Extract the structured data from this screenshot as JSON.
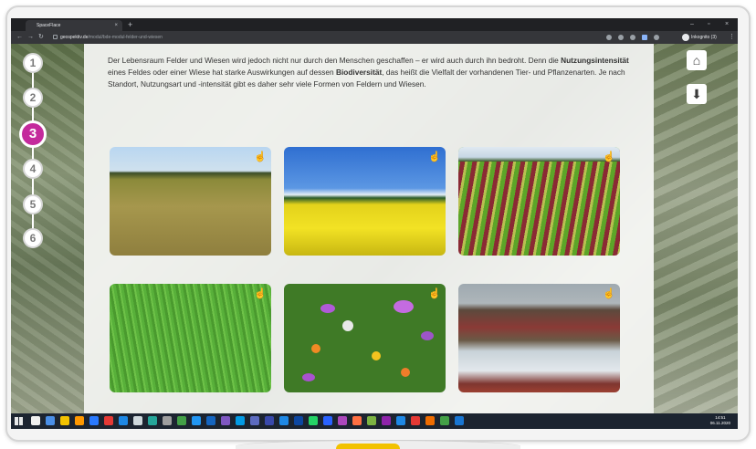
{
  "browser": {
    "tab_title": "SpaceFlace",
    "tab_close": "×",
    "new_tab": "+",
    "url_host": "geospektiv.de",
    "url_path": "/modul/bde-modul-felder-und-wiesen",
    "profile_label": "Inkognito (3)",
    "window_controls": [
      "–",
      "▫",
      "×"
    ]
  },
  "steps": [
    {
      "label": "1",
      "active": false
    },
    {
      "label": "2",
      "active": false
    },
    {
      "label": "3",
      "active": true
    },
    {
      "label": "4",
      "active": false
    },
    {
      "label": "5",
      "active": false
    },
    {
      "label": "6",
      "active": false
    }
  ],
  "side_buttons": {
    "home_icon": "home-icon",
    "down_icon": "arrow-down-circle-icon"
  },
  "intro": {
    "p1": "Der Lebensraum Felder und Wiesen wird jedoch nicht nur durch den Menschen geschaffen – er wird auch durch ihn bedroht. Denn die ",
    "b1": "Nutzungsintensität",
    "p2": " eines Feldes oder einer Wiese hat starke Auswirkungen auf dessen ",
    "b2": "Biodiversität",
    "p3": ", das heißt die Vielfalt der vorhandenen Tier- und Pflanzenarten. Je nach Standort, Nutzungsart und -intensität gibt es daher sehr viele Formen von Feldern und Wiesen."
  },
  "cards": [
    {
      "subject": "wheat-field",
      "icon": "hand-pointer-icon"
    },
    {
      "subject": "rapeseed-field",
      "icon": "hand-pointer-icon"
    },
    {
      "subject": "lettuce-rows",
      "icon": "hand-pointer-icon"
    },
    {
      "subject": "green-meadow",
      "icon": "hand-pointer-icon"
    },
    {
      "subject": "wildflower-meadow",
      "icon": "hand-pointer-icon"
    },
    {
      "subject": "wetland-meadow",
      "icon": "hand-pointer-icon"
    }
  ],
  "taskbar": {
    "time": "14:51",
    "date": "06.11.2020",
    "app_colors": [
      "#f0f0f0",
      "#4a8fe7",
      "#f2c200",
      "#ff9800",
      "#2979ff",
      "#e53935",
      "#1e88e5",
      "#cfd8dc",
      "#26a69a",
      "#9e9e9e",
      "#43a047",
      "#2196f3",
      "#1565c0",
      "#7e57c2",
      "#039be5",
      "#5c6bc0",
      "#3949ab",
      "#1e88e5",
      "#0d47a1",
      "#25d366",
      "#2962ff",
      "#ab47bc",
      "#ff7043",
      "#7cb342",
      "#8e24aa",
      "#1e88e5",
      "#e53935",
      "#ef6c00",
      "#43a047",
      "#1976d2"
    ]
  },
  "colors": {
    "accent_step": "#c42a9c",
    "page_text": "#333333"
  }
}
